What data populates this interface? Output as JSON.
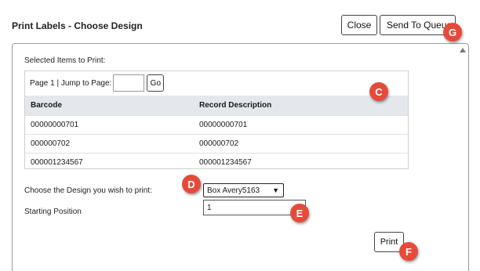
{
  "dialog": {
    "title": "Print Labels - Choose Design",
    "close_label": "Close",
    "send_to_queue_label": "Send To Queue"
  },
  "selected_items": {
    "label": "Selected Items to Print:",
    "pager_text": "Page 1 | Jump to Page:",
    "page_input_value": "",
    "go_label": "Go",
    "columns": [
      "Barcode",
      "Record Description"
    ],
    "rows": [
      [
        "00000000701",
        "00000000701"
      ],
      [
        "000000702",
        "000000702"
      ],
      [
        "000001234567",
        "000001234567"
      ]
    ]
  },
  "design": {
    "label": "Choose the Design you wish to print:",
    "selected": "Box Avery5163"
  },
  "starting_position": {
    "label": "Starting Position",
    "value": "1"
  },
  "print_label": "Print",
  "markers": {
    "c": "C",
    "d": "D",
    "e": "E",
    "f": "F",
    "g": "G"
  },
  "colors": {
    "marker": "#e64a3b",
    "table_header": "#e4e8ec"
  }
}
